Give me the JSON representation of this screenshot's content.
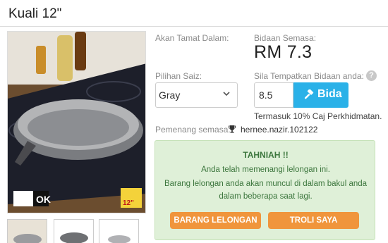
{
  "product": {
    "title": "Kuali 12\""
  },
  "auction": {
    "end_label": "Akan Tamat Dalam:",
    "current_bid_label": "Bidaan Semasa:",
    "current_bid_value": "RM 7.3",
    "size_label": "Pilihan Saiz:",
    "size_selected": "Gray",
    "place_bid_label": "Sila Tempatkan Bidaan anda:",
    "bid_input_value": "8.5",
    "bid_button_label": "Bida",
    "fee_note": "Termasuk 10% Caj Perkhidmatan.",
    "winner_label": "Pemenang semasa:",
    "winner_name": "hernee.nazir.102122",
    "help_glyph": "?"
  },
  "notice": {
    "heading": "TAHNIAH !!",
    "line1": "Anda telah memenangi lelongan ini.",
    "line2": "Barang lelongan anda akan muncul di dalam bakul anda",
    "line3": "dalam beberapa saat lagi.",
    "btn_items": "BARANG LELONGAN",
    "btn_cart": "TROLI SAYA"
  },
  "image": {
    "logo_text": "OK",
    "badge_text": "12\""
  },
  "icons": {
    "chevron": "chevron-down-icon",
    "hammer": "gavel-icon",
    "trophy": "trophy-icon",
    "help": "question-circle-icon"
  },
  "colors": {
    "bid_button": "#2ab1e8",
    "notice_bg": "#dff0d8",
    "notice_text": "#3c763d",
    "action_button": "#f0953c"
  }
}
